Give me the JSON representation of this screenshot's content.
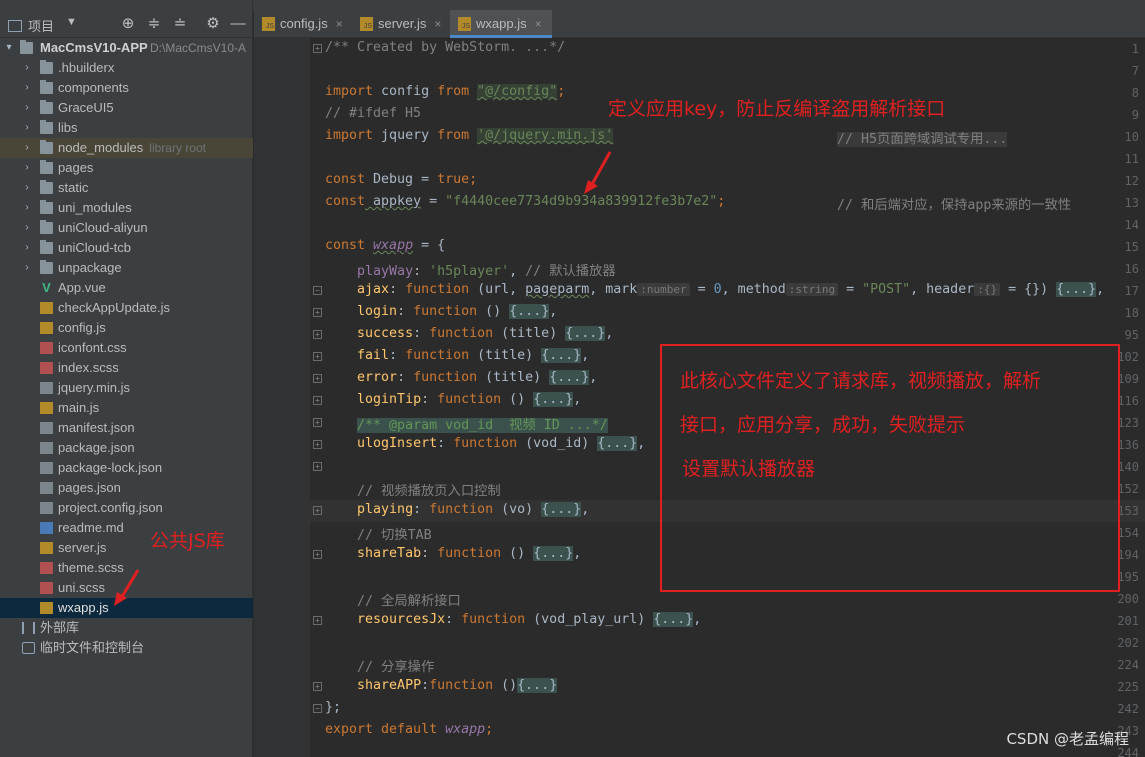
{
  "project_panel": {
    "title": "项目",
    "root": {
      "name": "MacCmsV10-APP",
      "path": "D:\\MacCmsV10-A"
    },
    "folders": [
      ".hbuilderx",
      "components",
      "GraceUI5",
      "libs",
      "node_modules",
      "pages",
      "static",
      "uni_modules",
      "uniCloud-aliyun",
      "uniCloud-tcb",
      "unpackage"
    ],
    "node_modules_hint": "library root",
    "files": [
      "App.vue",
      "checkAppUpdate.js",
      "config.js",
      "iconfont.css",
      "index.scss",
      "jquery.min.js",
      "main.js",
      "manifest.json",
      "package.json",
      "package-lock.json",
      "pages.json",
      "project.config.json",
      "readme.md",
      "server.js",
      "theme.scss",
      "uni.scss",
      "wxapp.js"
    ],
    "external_libs": "外部库",
    "scratches": "临时文件和控制台"
  },
  "tabs": [
    {
      "label": "config.js",
      "active": false
    },
    {
      "label": "server.js",
      "active": false
    },
    {
      "label": "wxapp.js",
      "active": true
    }
  ],
  "editor": {
    "line_numbers": [
      "1",
      "7",
      "8",
      "9",
      "10",
      "11",
      "12",
      "13",
      "14",
      "15",
      "16",
      "17",
      "18",
      "95",
      "102",
      "109",
      "116",
      "123",
      "136",
      "140",
      "152",
      "153",
      "154",
      "194",
      "195",
      "200",
      "201",
      "202",
      "224",
      "225",
      "242",
      "243",
      "244"
    ],
    "code": {
      "l1": "/** Created by WebStorm. ...*/",
      "l8_kw": "import",
      "l8_id": " config ",
      "l8_from": "from",
      "l8_str": "\"@/config\"",
      "l9": "// #ifdef H5",
      "l10_kw": "import",
      "l10_id": " jquery ",
      "l10_from": "from",
      "l10_str": "'@/jquery.min.js'",
      "l10_cmt": "// H5页面跨域调试专用...",
      "l13_kw": "const",
      "l13_rest": " Debug = ",
      "l13_val": "true",
      "l14_kw": "const",
      "l14_id": " appkey",
      "l14_eq": " = ",
      "l14_str": "\"f4440cee7734d9b934a839912fe3b7e2\"",
      "l14_cmt": "// 和后端对应，保持app来源的一致性",
      "l16_kw": "const",
      "l16_id": "wxapp",
      "l16_rest": " = {",
      "l17_prop": "playWay",
      "l17_str": "'h5player'",
      "l17_cmt": "// 默认播放器",
      "l18_prop": "ajax",
      "l18_fn": "function",
      "l18_args": " (url, ",
      "l18_p2": "pageparm",
      "l18_p3": ", mark",
      "l18_hint1": ":number",
      "l18_eq0": " = ",
      "l18_zero": "0",
      "l18_method": ", method",
      "l18_hint2": ":string",
      "l18_post": "\"POST\"",
      "l18_header": ", header",
      "l18_hint3": ":{}",
      "l18_end": " = {}) ",
      "fold": "{...}",
      "l95_prop": "login",
      "l102_prop": "success",
      "l109_prop": "fail",
      "l116_prop": "error",
      "l123_prop": "loginTip",
      "l136_doc": "/** @param vod_id  视频 ID ...*/",
      "l140_prop": "ulogInsert",
      "l153_cmt": "// 视频播放页入口控制",
      "l154_prop": "playing",
      "l194_cmt": "// 切换TAB",
      "l195_prop": "shareTab",
      "l201_cmt": "// 全局解析接口",
      "l202_prop": "resourcesJx",
      "l224_cmt": "// 分享操作",
      "l225_prop": "shareAPP",
      "l242": "};",
      "l243_kw": "export default",
      "l243_id": "wxapp",
      "fn": "function",
      "args_title": "(title)",
      "args_empty": "()",
      "args_vod": "(vod_id)",
      "args_vo": "(vo)",
      "args_url": "(vod_play_url)"
    }
  },
  "annotations": {
    "top": "定义应用key，防止反编译盗用解析接口",
    "box_line1": "此核心文件定义了请求库，视频播放，解析",
    "box_line2": "接口，应用分享，成功，失败提示",
    "box_line3": "设置默认播放器",
    "left": "公共JS库"
  },
  "watermark": "CSDN @老孟编程"
}
